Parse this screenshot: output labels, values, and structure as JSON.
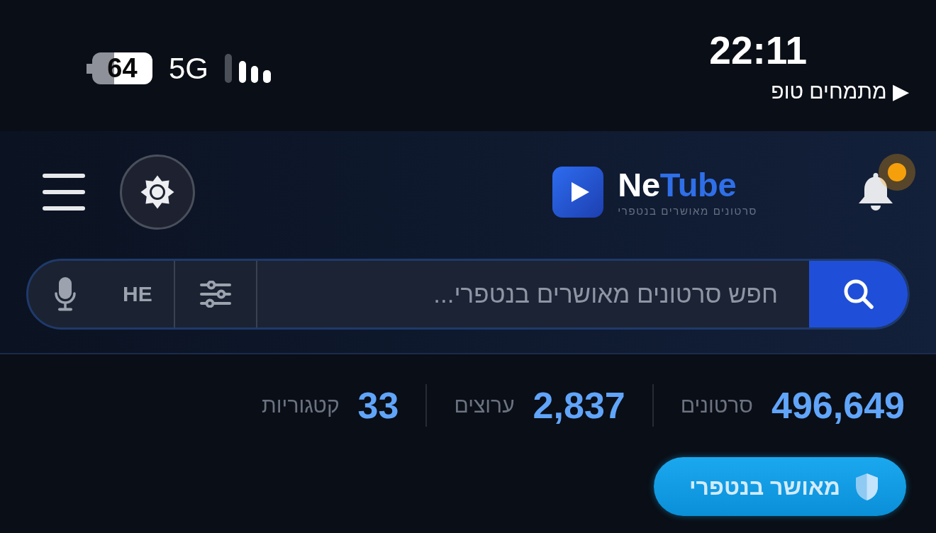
{
  "status_bar": {
    "battery_percent": "64",
    "network": "5G",
    "time": "22:11",
    "back_link": "▶ מתמחים טופ"
  },
  "header": {
    "logo": {
      "wordmark": {
        "lead": "Ne",
        "accent": "Tube"
      },
      "tagline": "סרטונים מאושרים בנטפרי"
    },
    "notifications": {
      "unread": true
    }
  },
  "search": {
    "language": "HE",
    "placeholder": "חפש סרטונים מאושרים בנטפרי..."
  },
  "stats": [
    {
      "value": "496,649",
      "label": "סרטונים"
    },
    {
      "value": "2,837",
      "label": "ערוצים"
    },
    {
      "value": "33",
      "label": "קטגוריות"
    }
  ],
  "verified_button": {
    "label": "מאושר בנטפרי"
  }
}
